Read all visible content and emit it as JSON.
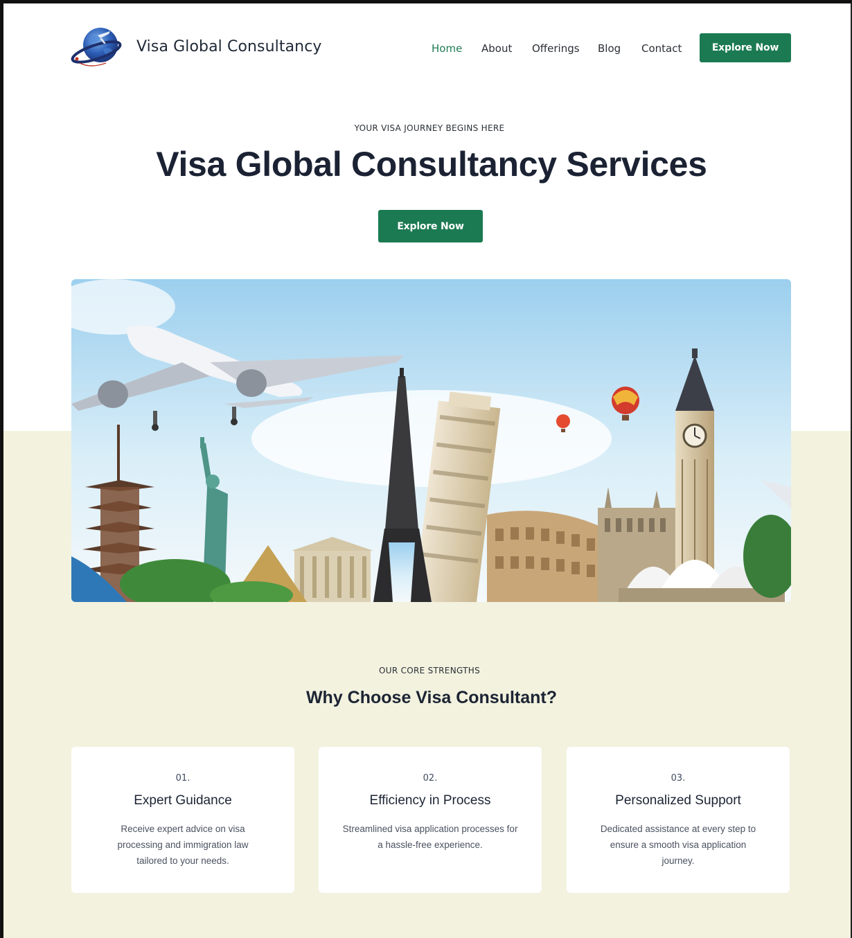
{
  "header": {
    "brand": "Visa Global Consultancy",
    "nav": [
      {
        "label": "Home",
        "active": true
      },
      {
        "label": "About",
        "active": false
      },
      {
        "label": "Offerings",
        "active": false
      },
      {
        "label": "Blog",
        "active": false
      },
      {
        "label": "Contact",
        "active": false
      }
    ],
    "cta_label": "Explore Now"
  },
  "hero": {
    "eyebrow": "YOUR VISA JOURNEY BEGINS HERE",
    "title": "Visa Global Consultancy Services",
    "cta_label": "Explore Now",
    "image_alt": "travel-landmarks-collage"
  },
  "strengths": {
    "eyebrow": "OUR CORE STRENGTHS",
    "title": "Why Choose Visa Consultant?",
    "cards": [
      {
        "number": "01.",
        "title": "Expert Guidance",
        "description": "Receive expert advice on visa processing and immigration law tailored to your needs."
      },
      {
        "number": "02.",
        "title": "Efficiency in Process",
        "description": "Streamlined visa application processes for a hassle-free experience."
      },
      {
        "number": "03.",
        "title": "Personalized Support",
        "description": "Dedicated assistance at every step to ensure a smooth visa application journey."
      }
    ]
  },
  "colors": {
    "accent": "#1c7a52",
    "band": "#f2f2df",
    "heading": "#1b2233"
  }
}
